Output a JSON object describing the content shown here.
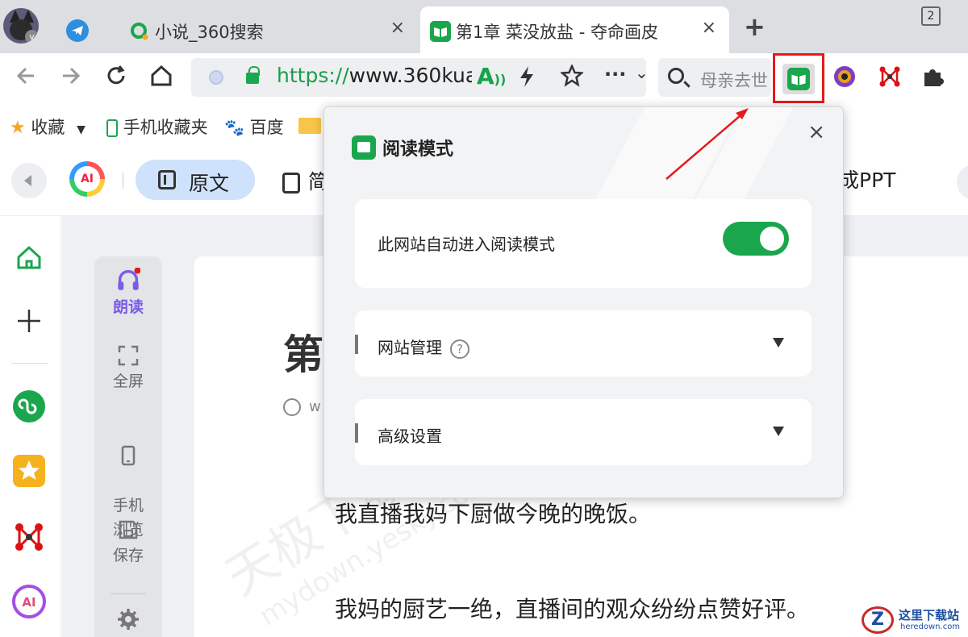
{
  "tabs": [
    {
      "label": "小说_360搜索",
      "close": "×"
    },
    {
      "label": "第1章 菜没放盐 - 夺命画皮",
      "close": "×"
    }
  ],
  "avatar_badge": "v",
  "new_tab": "+",
  "tab_count": "2",
  "toolbar": {
    "url_scheme": "https://",
    "url_rest": "www.360kua",
    "search_placeholder": "母亲去世",
    "more": "···",
    "dropdown": "⌄"
  },
  "bookmarks": [
    {
      "label": "收藏"
    },
    {
      "label": "手机收藏夹"
    },
    {
      "label": "百度"
    }
  ],
  "aibar": {
    "ai_label": "AI",
    "original_label": "原文",
    "summary_label": "简",
    "ppt_label": "成PPT"
  },
  "toolpanel": [
    {
      "label": "朗读"
    },
    {
      "label": "全屏"
    },
    {
      "label": "手机\n浏览"
    },
    {
      "label": "保存"
    }
  ],
  "article": {
    "title": "第",
    "meta": "w",
    "para1": "我直播我妈下厨做今晚的晚饭。",
    "para2": "我妈的厨艺一绝，直播间的观众纷纷点赞好评。"
  },
  "popup": {
    "title": "阅读模式",
    "close": "×",
    "auto_label": "此网站自动进入阅读模式",
    "auto_enabled": true,
    "site_manage": "网站管理",
    "help": "?",
    "advanced": "高级设置"
  },
  "watermark": {
    "line1": "天极下载站",
    "line2": "mydown.yesky.com"
  },
  "site_logo": {
    "mark": "Z",
    "name": "这里下载站",
    "domain": "heredown.com"
  },
  "colors": {
    "accent_green": "#1aa64d",
    "highlight_red": "#e51b1b",
    "tab_bg": "#dcdee1"
  }
}
